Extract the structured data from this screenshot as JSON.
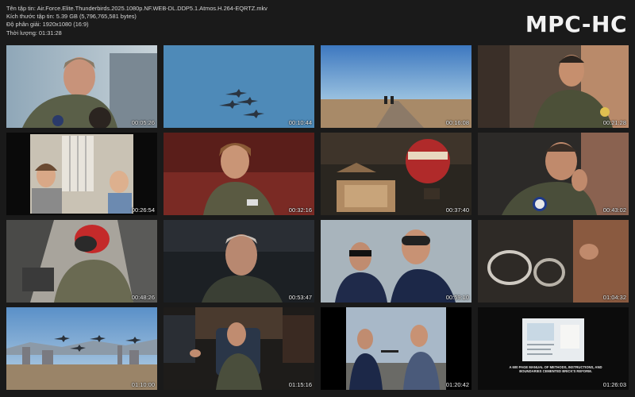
{
  "header": {
    "line1": "Tên tập tin: Air.Force.Elite.Thunderbirds.2025.1080p.NF.WEB-DL.DDP5.1.Atmos.H.264-EQRTZ.mkv",
    "line2": "Kích thước tập tin: 5.39 GB (5,796,765,581 bytes)",
    "line3": "Độ phân giải: 1920x1080 (16:9)",
    "line4": "Thời lượng: 01:31:28"
  },
  "logo": "MPC-HC",
  "thumbnails": [
    {
      "timestamp": "00:05:26"
    },
    {
      "timestamp": "00:10:44"
    },
    {
      "timestamp": "00:16:08"
    },
    {
      "timestamp": "00:21:28"
    },
    {
      "timestamp": "00:26:54"
    },
    {
      "timestamp": "00:32:16"
    },
    {
      "timestamp": "00:37:40"
    },
    {
      "timestamp": "00:43:02"
    },
    {
      "timestamp": "00:48:26"
    },
    {
      "timestamp": "00:53:47"
    },
    {
      "timestamp": "00:59:10"
    },
    {
      "timestamp": "01:04:32"
    },
    {
      "timestamp": "01:10:00"
    },
    {
      "timestamp": "01:15:16"
    },
    {
      "timestamp": "01:20:42"
    },
    {
      "timestamp": "01:26:03",
      "caption": "A 600 PAGE MANUAL OF METHODS, INSTRUCTIONS, AND BOUNDARIES CEMENTED BRICK'S REFORM."
    }
  ]
}
